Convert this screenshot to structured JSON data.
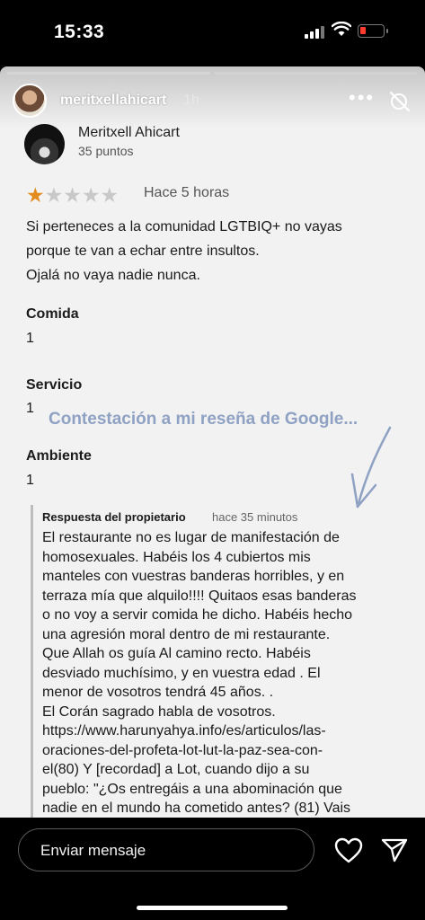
{
  "status_bar": {
    "time": "15:33"
  },
  "story": {
    "username": "meritxellahicart",
    "time_ago": "1h",
    "more_label": "•••"
  },
  "review": {
    "reviewer_name": "Meritxell Ahicart",
    "reviewer_points": "35 puntos",
    "rating": 1,
    "rating_max": 5,
    "time": "Hace 5 horas",
    "text_lines": [
      "Si perteneces a la comunidad LGTBIQ+ no vayas",
      "porque te van a echar entre insultos.",
      "Ojalá no vaya nadie nunca."
    ],
    "food_label": "Comida",
    "food_value": "1",
    "service_label": "Servicio",
    "service_value": "1",
    "ambience_label": "Ambiente",
    "ambience_value": "1"
  },
  "annotation": "Contestación a mi reseña de Google...",
  "owner_reply": {
    "label": "Respuesta del propietario",
    "time": "hace 35 minutos",
    "text_lines": [
      "El restaurante no es lugar de manifestación de",
      "homosexuales. Habéis los 4 cubiertos mis",
      "manteles con vuestras banderas horribles, y en",
      "terraza mía que alquilo!!!!  Quitaos esas banderas",
      "o no voy a servir comida he dicho. Habéis hecho",
      "una agresión moral dentro de mi restaurante.",
      "Que Allah os guía Al camino recto. Habéis",
      "desviado muchísimo, y en vuestra edad . El",
      "menor de vosotros tendrá 45 años.  .",
      "El Corán sagrado habla de vosotros.",
      "https://www.harunyahya.info/es/articulos/las-",
      "oraciones-del-profeta-lot-lut-la-paz-sea-con-",
      "el(80) Y [recordad] a Lot, cuando dijo a su",
      "pueblo: \"¿Os entregáis a una abominación que",
      "nadie en el mundo ha cometido antes? (81) Vais"
    ]
  },
  "bottom_bar": {
    "message_placeholder": "Enviar mensaje"
  },
  "colors": {
    "star_filled": "#e38b1c",
    "annotation": "#8fa2c4",
    "battery_low": "#ff3b30"
  }
}
